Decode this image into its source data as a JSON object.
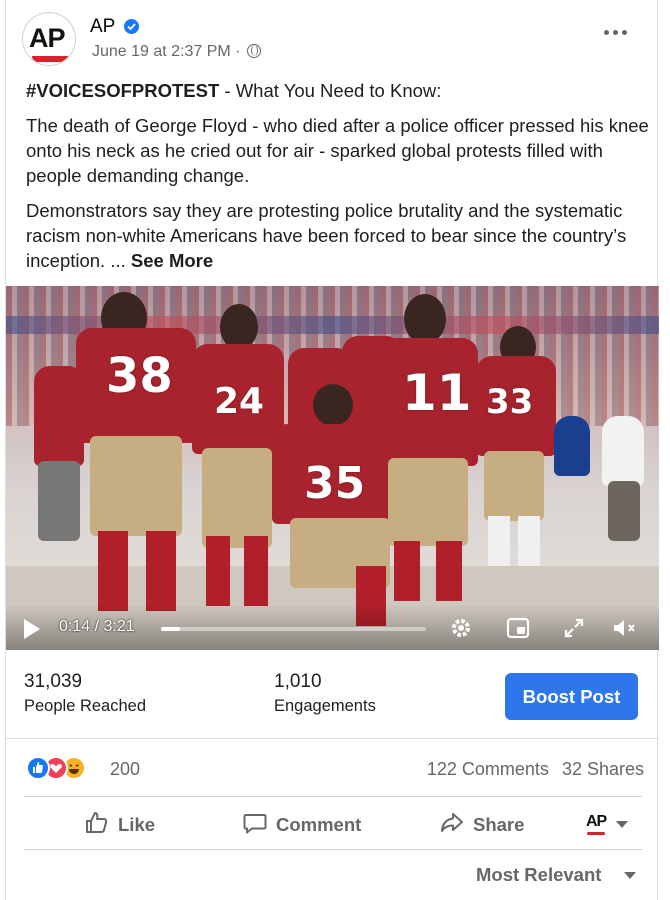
{
  "post": {
    "page_name": "AP",
    "timestamp": "June 19 at 2:37 PM ·",
    "headline_tag": "#VOICESOFPROTEST",
    "headline_rest": " - What You Need to Know:",
    "paragraph1": "The death of George Floyd - who died after a police officer pressed his knee onto his neck as he cried out for air -  sparked global protests filled with people demanding change.",
    "paragraph2": "Demonstrators say they are protesting police brutality and the systematic racism non-white Americans have been forced to bear since the country’s inception. ... ",
    "see_more": "See More",
    "avatar_text": "AP"
  },
  "video": {
    "time": "0:14 / 3:21",
    "progress": 0.07,
    "jersey_numbers": [
      "38",
      "24",
      "35",
      "11",
      "33"
    ]
  },
  "stats": {
    "reached_value": "31,039",
    "reached_label": "People Reached",
    "engagements_value": "1,010",
    "engagements_label": "Engagements",
    "boost_label": "Boost Post"
  },
  "reactions": {
    "count": "200",
    "comments": "122 Comments",
    "shares": "32 Shares"
  },
  "actions": {
    "like": "Like",
    "comment": "Comment",
    "share": "Share",
    "profile_text": "AP"
  },
  "sort": {
    "label": "Most Relevant"
  },
  "colors": {
    "accent": "#2d77ea",
    "verified": "#1877f2",
    "brand_red": "#d8232a"
  }
}
